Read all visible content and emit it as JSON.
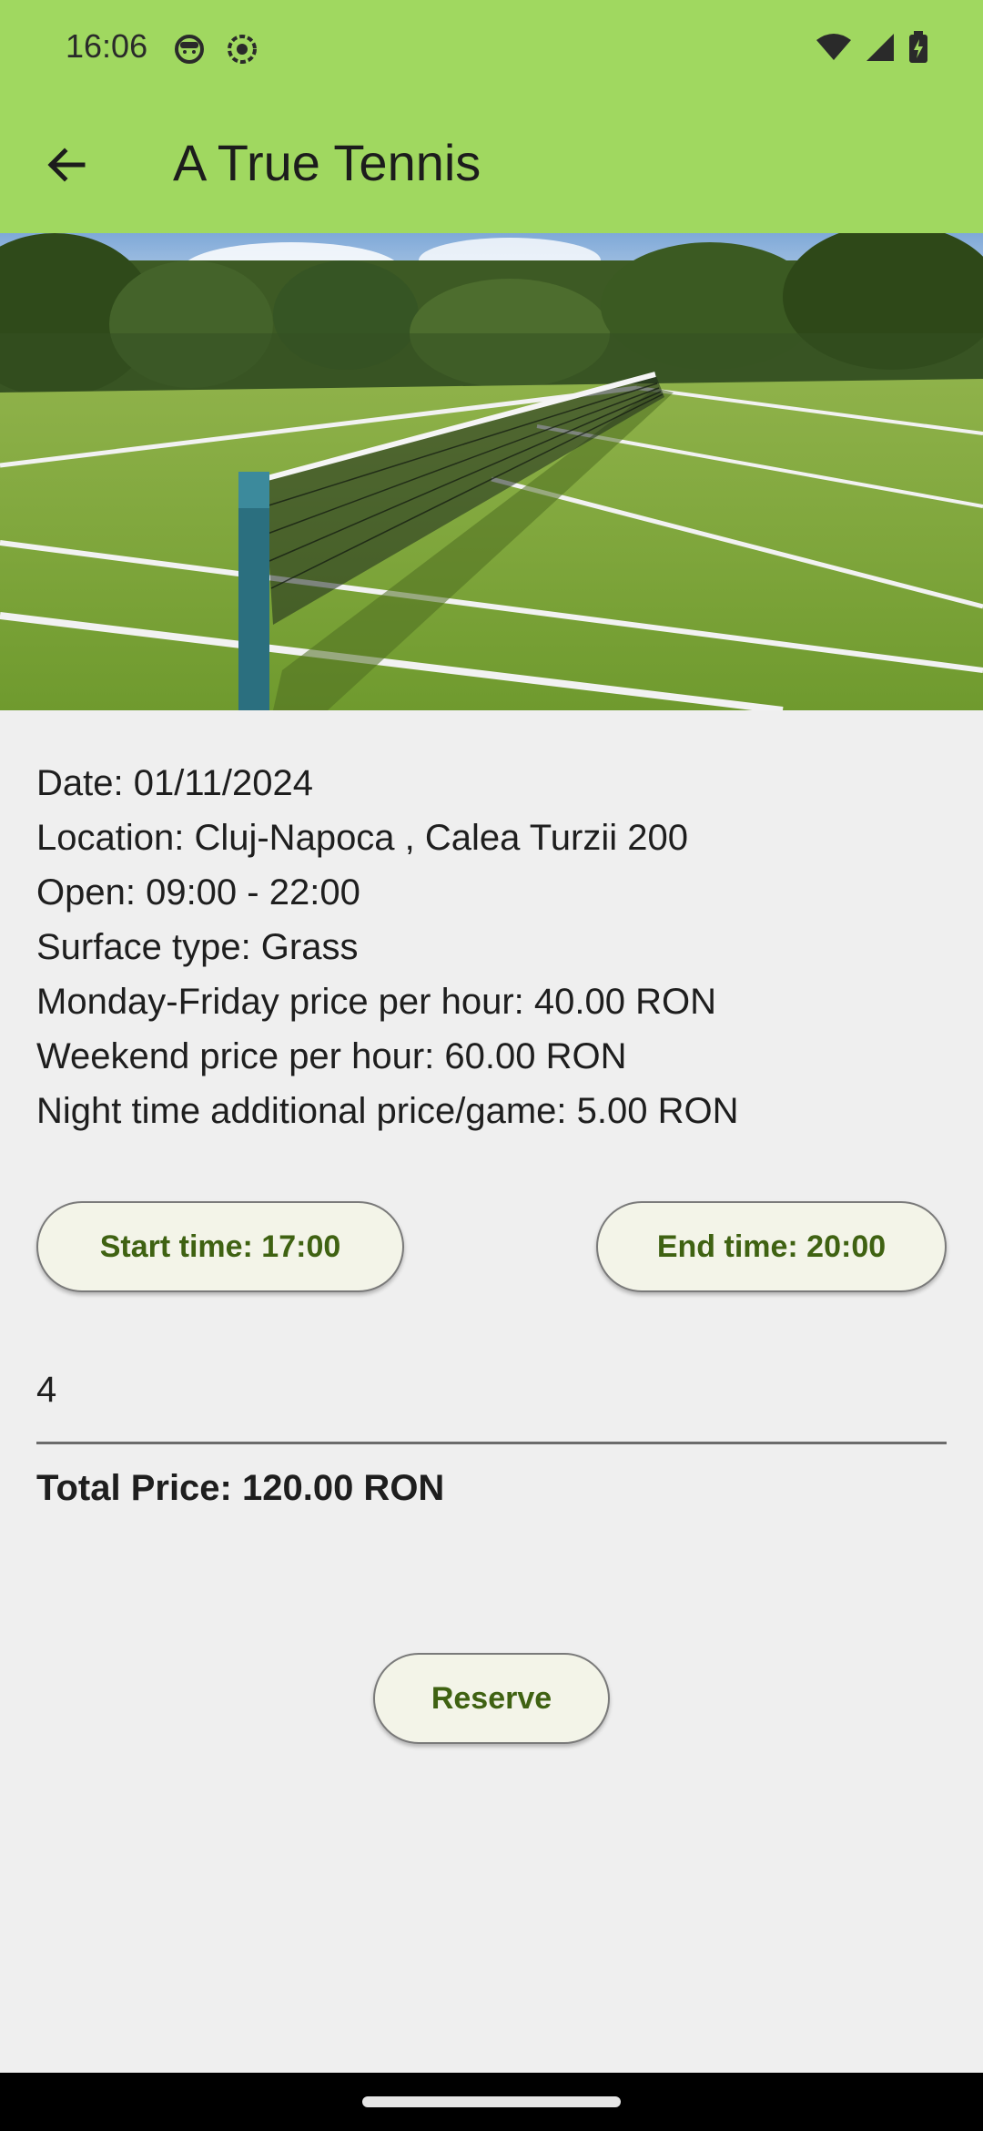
{
  "status_bar": {
    "time": "16:06",
    "icons_left": [
      "face-icon",
      "record-icon"
    ],
    "icons_right": [
      "wifi-icon",
      "signal-icon",
      "battery-icon"
    ],
    "background": "#a0d860"
  },
  "app_bar": {
    "title": "A True Tennis",
    "back_icon": "arrow-left-icon",
    "background": "#a0d860"
  },
  "details": {
    "date": "Date: 01/11/2024",
    "location": "Location: Cluj-Napoca , Calea Turzii 200",
    "open": "Open: 09:00 - 22:00",
    "surface": "Surface type: Grass",
    "weekday_price": "Monday-Friday price per hour: 40.00 RON",
    "weekend_price": "Weekend price per hour: 60.00 RON",
    "night_price": "Night time additional price/game: 5.00 RON"
  },
  "time_selection": {
    "start_label": "Start time: 17:00",
    "end_label": "End time: 20:00"
  },
  "hours_input": {
    "value": "4"
  },
  "total": {
    "label": "Total Price: 120.00 RON"
  },
  "actions": {
    "reserve_label": "Reserve"
  },
  "colors": {
    "accent": "#a0d860",
    "button_text": "#3f6212",
    "button_bg": "#f3f4e8",
    "page_bg": "#efefef"
  }
}
